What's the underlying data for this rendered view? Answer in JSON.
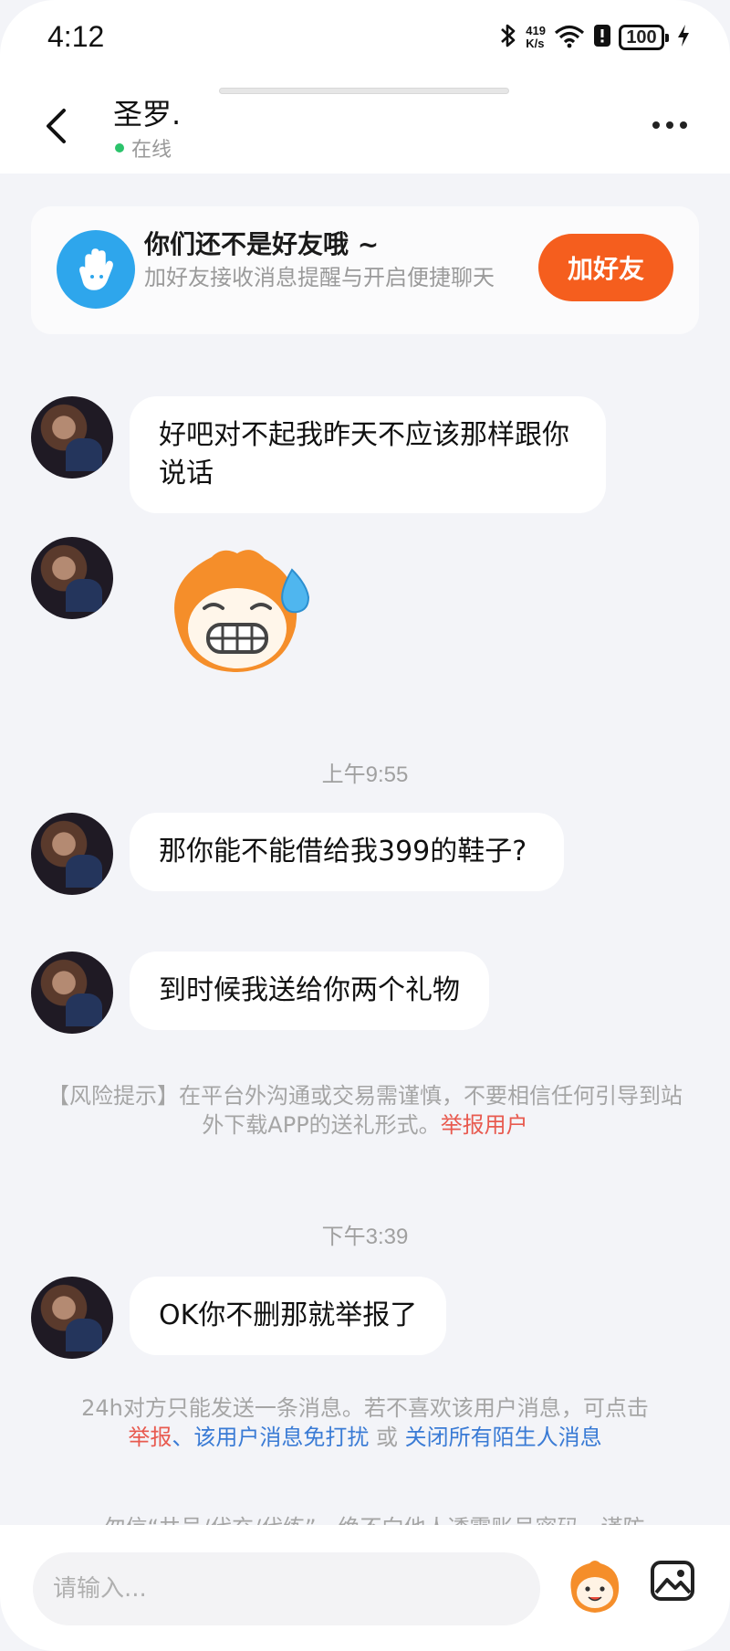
{
  "status_bar": {
    "time": "4:12",
    "net_speed_value": "419",
    "net_speed_unit": "K/s",
    "battery": "100"
  },
  "header": {
    "contact_name": "圣罗.",
    "status": "在线"
  },
  "friend_banner": {
    "title": "你们还不是好友哦 ~",
    "subtitle": "加好友接收消息提醒与开启便捷聊天",
    "button": "加好友"
  },
  "messages": {
    "m1": "好吧对不起我昨天不应该那样跟你说话",
    "t1": "上午9:55",
    "m2": "那你能不能借给我399的鞋子?",
    "m3": "到时候我送给你两个礼物",
    "t2": "下午3:39",
    "m4": "OK你不删那就举报了"
  },
  "risk_notice": {
    "text": "【风险提示】在平台外沟通或交易需谨慎，不要相信任何引导到站外下载APP的送礼形式。",
    "link": "举报用户"
  },
  "limit_notice": {
    "text": "24h对方只能发送一条消息。若不喜欢该用户消息，可点击",
    "link_report": "举报",
    "sep": "、",
    "link_mute": "该用户消息免打扰",
    "or": " 或 ",
    "link_close": "关闭所有陌生人消息"
  },
  "partial_notice": {
    "text": "勿信“共号/代充/代练”，绝不向他人透露账号密码，谨防"
  },
  "input": {
    "placeholder": "请输入..."
  },
  "colors": {
    "accent": "#f55e1e",
    "online": "#2bc36b",
    "link_red": "#e85a4f",
    "link_blue": "#3a7bd5"
  }
}
